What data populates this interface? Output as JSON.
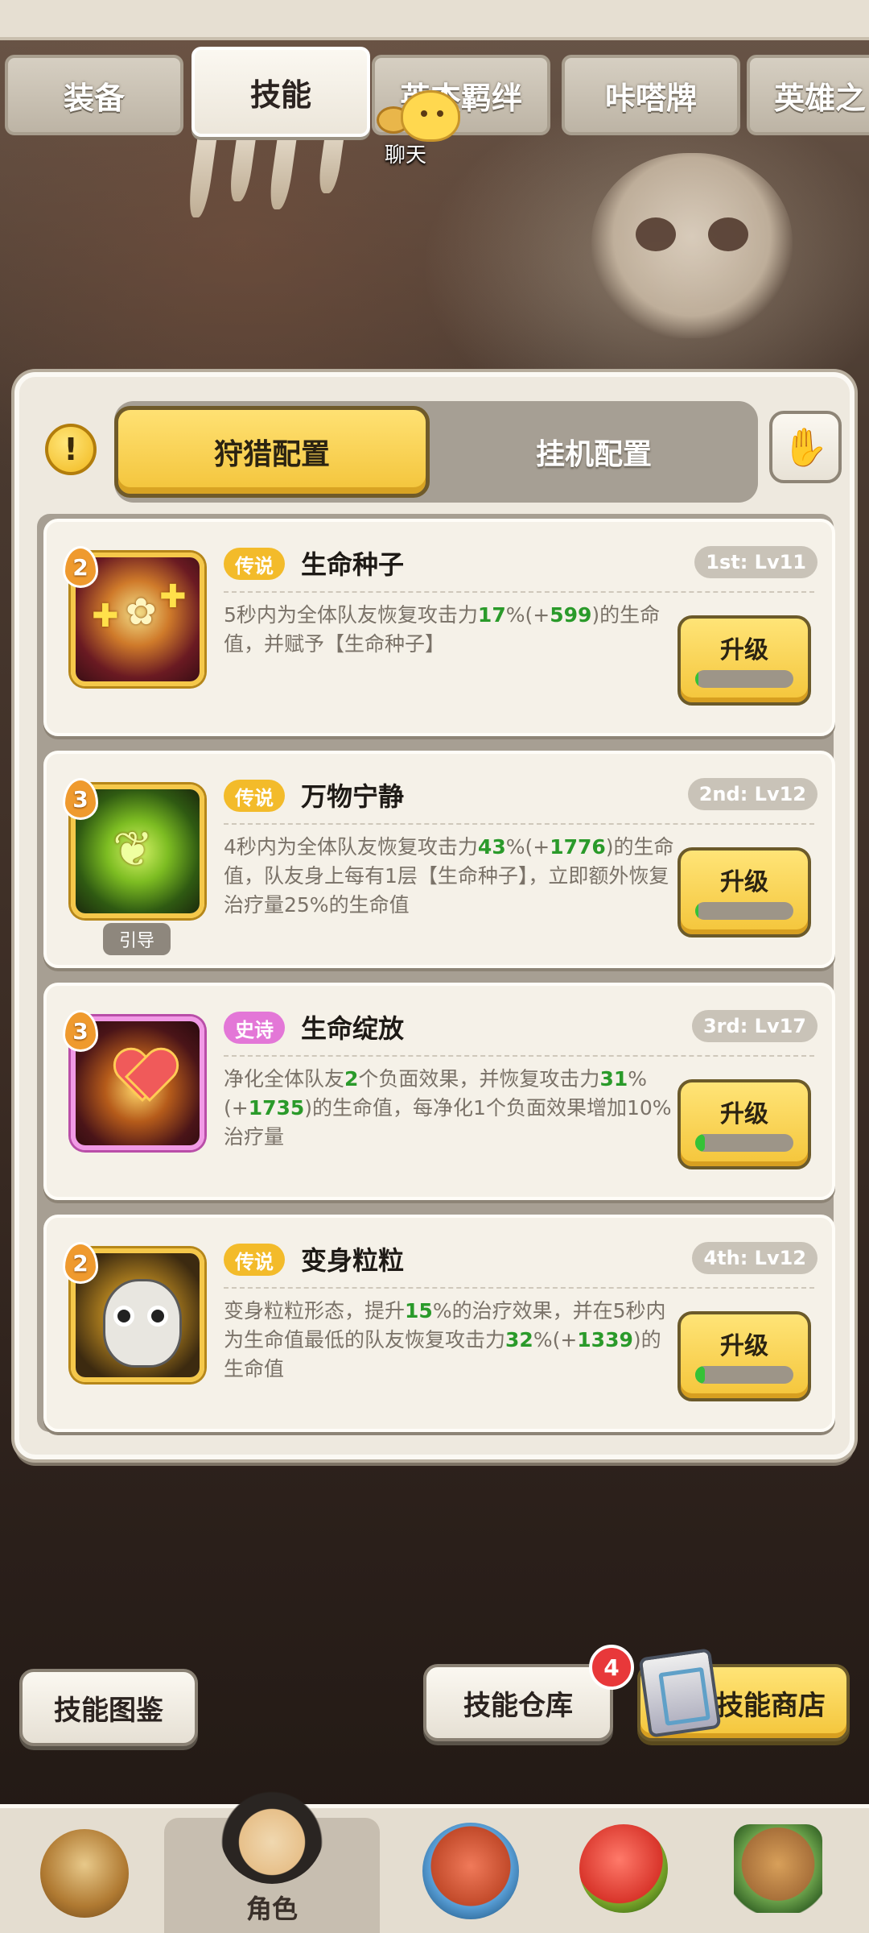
{
  "tabs": [
    {
      "label": "装备"
    },
    {
      "label": "技能"
    },
    {
      "label": "英杰羁绊"
    },
    {
      "label": "咔嗒牌"
    },
    {
      "label": "英雄之"
    }
  ],
  "active_tab": "技能",
  "chat": {
    "label": "聊天"
  },
  "config": {
    "warn_icon": "!",
    "hunt_label": "狩猎配置",
    "idle_label": "挂机配置",
    "help_icon": "help-card-icon"
  },
  "skills": [
    {
      "level": "2",
      "rarity": "传说",
      "name": "生命种子",
      "slot": "1st: Lv11",
      "desc_parts": [
        "5秒内为全体队友恢复攻击力",
        "17",
        "%(+",
        "599",
        ")的生命值，并赋予【生命种子】"
      ],
      "upgrade_label": "升级",
      "progress": 0.03
    },
    {
      "level": "3",
      "rarity": "传说",
      "name": "万物宁静",
      "slot": "2nd: Lv12",
      "desc_parts": [
        "4秒内为全体队友恢复攻击力",
        "43",
        "%(+",
        "1776",
        ")的生命值，队友身上每有1层【生命种子】，立即额外恢复治疗量25%的生命值"
      ],
      "tag": "引导",
      "upgrade_label": "升级",
      "progress": 0.03
    },
    {
      "level": "3",
      "rarity": "史诗",
      "name": "生命绽放",
      "slot": "3rd: Lv17",
      "desc_parts": [
        "净化全体队友",
        "2",
        "个负面效果，并恢复攻击力",
        "31",
        "%(+",
        "1735",
        ")的生命值，每净化1个负面效果增加10%治疗量"
      ],
      "upgrade_label": "升级",
      "progress": 0.1
    },
    {
      "level": "2",
      "rarity": "传说",
      "name": "变身粒粒",
      "slot": "4th: Lv12",
      "desc_parts": [
        "变身粒粒形态，提升",
        "15",
        "%的治疗效果，并在5秒内为生命值最低的队友恢复攻击力",
        "32",
        "%(+",
        "1339",
        ")的生命值"
      ],
      "upgrade_label": "升级",
      "progress": 0.1
    }
  ],
  "bottom": {
    "codex_label": "技能图鉴",
    "storage_label": "技能仓库",
    "storage_badge": "4",
    "shop_label": "技能商店"
  },
  "nav": [
    {
      "label": "",
      "icon": "hero-viking-icon"
    },
    {
      "label": "角色",
      "icon": "role-avatar-icon"
    },
    {
      "label": "",
      "icon": "tribal-mask-icon"
    },
    {
      "label": "",
      "icon": "red-dino-icon"
    },
    {
      "label": "",
      "icon": "totem-icon"
    }
  ],
  "colors": {
    "accent_yellow": "#f4c53a",
    "legend": "#f3bb2a",
    "epic": "#e377d7",
    "value_green": "#2a9a2a",
    "badge_red": "#e8383a"
  }
}
